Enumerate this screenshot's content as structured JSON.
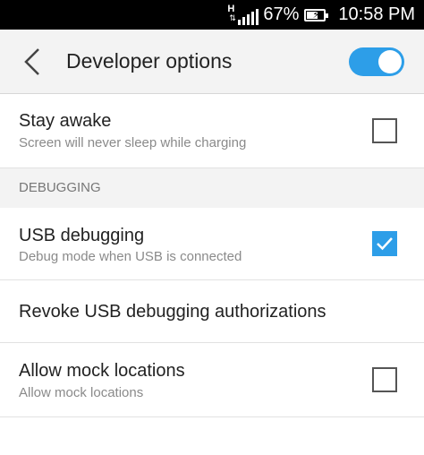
{
  "status_bar": {
    "network_type": "H",
    "battery_percent": "67%",
    "battery_level": 0.67,
    "time": "10:58 PM"
  },
  "app_bar": {
    "title": "Developer options",
    "back_icon": "chevron-left-icon",
    "master_toggle_on": true
  },
  "accent_color": "#2d9ee8",
  "settings": {
    "stay_awake": {
      "label": "Stay awake",
      "summary": "Screen will never sleep while charging",
      "checked": false
    },
    "debugging_header": "DEBUGGING",
    "usb_debugging": {
      "label": "USB debugging",
      "summary": "Debug mode when USB is connected",
      "checked": true
    },
    "revoke_usb": {
      "label": "Revoke USB debugging authorizations"
    },
    "mock_locations": {
      "label": "Allow mock locations",
      "summary": "Allow mock locations",
      "checked": false
    }
  }
}
